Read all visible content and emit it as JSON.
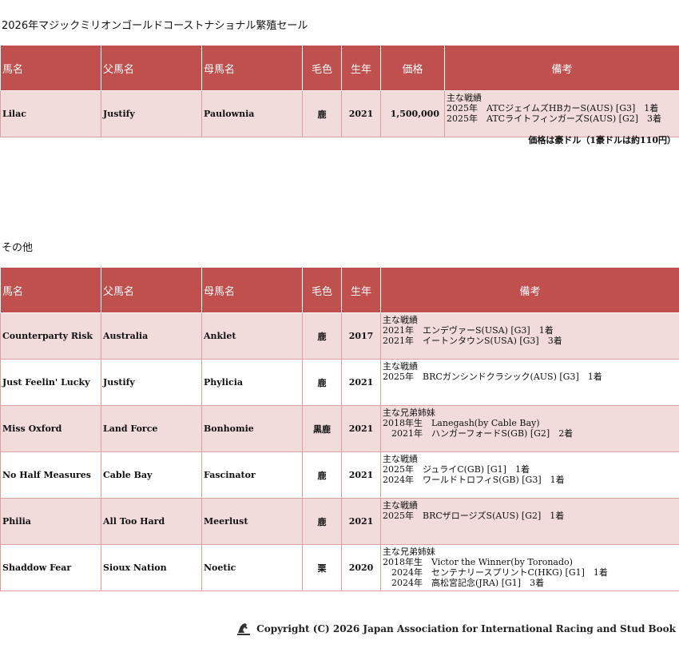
{
  "page": {
    "title": "2026年マジックミリオンゴールドコーストナショナル繁殖セール",
    "other_section_title": "その他",
    "price_note": "価格は豪ドル（1豪ドルは約110円）",
    "copyright": "Copyright (C) 2026 Japan Association for International Racing and Stud Book"
  },
  "colors": {
    "header_bg": "#c0504d",
    "row_pink": "#f2dcdb",
    "row_white": "#ffffff"
  },
  "main_table": {
    "headers": [
      "馬名",
      "父馬名",
      "母馬名",
      "毛色",
      "生年",
      "価格",
      "備考"
    ],
    "rows": [
      {
        "name": "Lilac",
        "sire": "Justify",
        "dam": "Paulownia",
        "color": "鹿",
        "year": "2021",
        "price": "1,500,000",
        "notes": "主な戦績\n2025年　ATCジェイムズHBカーS(AUS) [G3]　1着\n2025年　ATCライトフィンガーズS(AUS) [G2]　3着"
      }
    ]
  },
  "other_table": {
    "headers": [
      "馬名",
      "父馬名",
      "母馬名",
      "毛色",
      "生年",
      "備考"
    ],
    "rows": [
      {
        "name": "Counterparty Risk",
        "sire": "Australia",
        "dam": "Anklet",
        "color": "鹿",
        "year": "2017",
        "notes": "主な戦績\n2021年　エンデヴァーS(USA) [G3]　1着\n2021年　イートンタウンS(USA) [G3]　3着"
      },
      {
        "name": "Just Feelin' Lucky",
        "sire": "Justify",
        "dam": "Phylicia",
        "color": "鹿",
        "year": "2021",
        "notes": "主な戦績\n2025年　BRCガンシンドクラシック(AUS) [G3]　1着"
      },
      {
        "name": "Miss Oxford",
        "sire": "Land Force",
        "dam": "Bonhomie",
        "color": "黒鹿",
        "year": "2021",
        "notes": "主な兄弟姉妹\n2018年生　Lanegash(by Cable Bay)\n　2021年　ハンガーフォードS(GB) [G2]　2着"
      },
      {
        "name": "No Half Measures",
        "sire": "Cable Bay",
        "dam": "Fascinator",
        "color": "鹿",
        "year": "2021",
        "notes": "主な戦績\n2025年　ジュライC(GB) [G1]　1着\n2024年　ワールドトロフィS(GB) [G3]　1着"
      },
      {
        "name": "Philia",
        "sire": "All Too Hard",
        "dam": "Meerlust",
        "color": "鹿",
        "year": "2021",
        "notes": "主な戦績\n2025年　BRCザロージズS(AUS) [G2]　1着"
      },
      {
        "name": "Shaddow Fear",
        "sire": "Sioux Nation",
        "dam": "Noetic",
        "color": "栗",
        "year": "2020",
        "notes": "主な兄弟姉妹\n2018年生　Victor the Winner(by Toronado)\n　2024年　センテナリースプリントC(HKG) [G1]　1着\n　2024年　高松宮記念(JRA) [G1]　3着"
      }
    ]
  }
}
